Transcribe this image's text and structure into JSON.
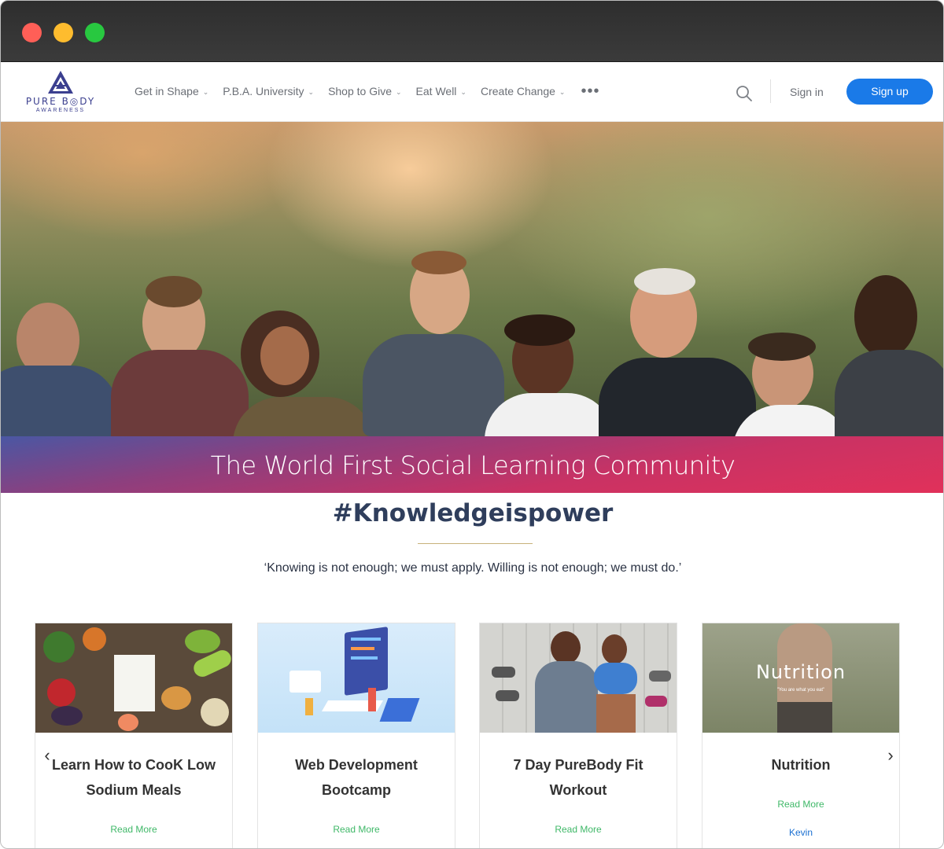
{
  "logo": {
    "text": "PURE B◎DY",
    "sub": "AWARENESS"
  },
  "nav": {
    "items": [
      {
        "label": "Get in Shape"
      },
      {
        "label": "P.B.A. University"
      },
      {
        "label": "Shop to Give"
      },
      {
        "label": "Eat Well"
      },
      {
        "label": "Create Change"
      }
    ],
    "more": "•••"
  },
  "auth": {
    "signin": "Sign in",
    "signup": "Sign up"
  },
  "banner": {
    "title": "The World First Social Learning Community"
  },
  "hashtag": "#Knowledgeispower",
  "quote": "‘Knowing is not enough; we must apply. Willing is not enough; we must do.’",
  "cards": [
    {
      "title": "Learn How to CooK Low Sodium Meals",
      "link": "Read More"
    },
    {
      "title": "Web Development Bootcamp",
      "link": "Read More"
    },
    {
      "title": "7 Day PureBody Fit Workout",
      "link": "Read More"
    },
    {
      "title": "Nutrition",
      "link": "Read More",
      "author": "Kevin",
      "image_text": "Nutrition",
      "image_sub": "\"You are what you eat\""
    }
  ],
  "carousel": {
    "prev": "‹",
    "next": "›"
  },
  "colors": {
    "accent": "#1a7ae8",
    "link_green": "#3fb868",
    "heading": "#2f3e5c"
  }
}
